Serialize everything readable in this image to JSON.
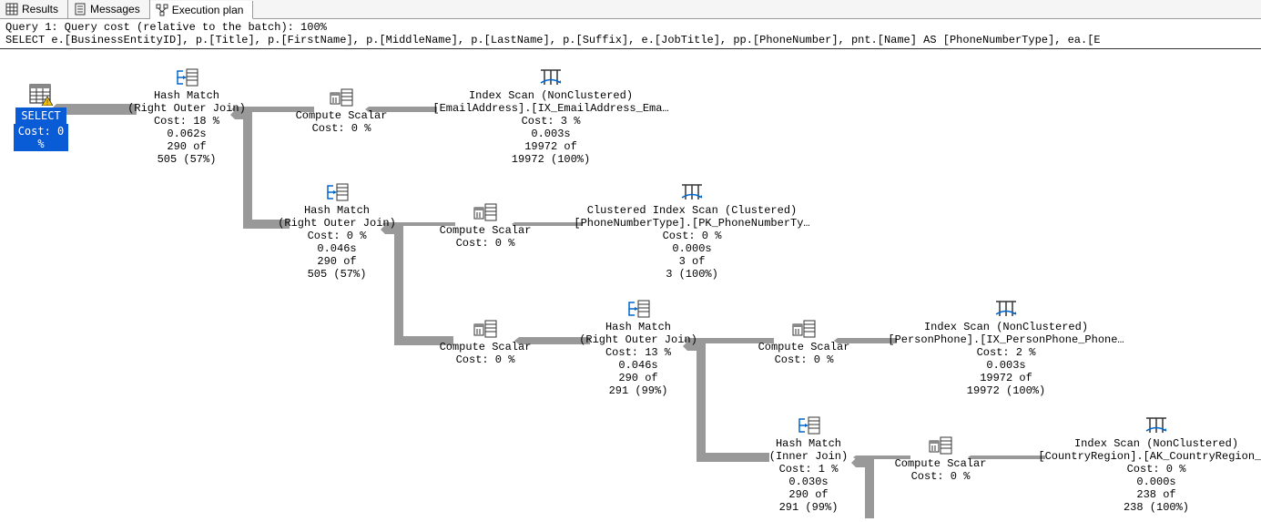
{
  "tabs": {
    "results": "Results",
    "messages": "Messages",
    "exec_plan": "Execution plan"
  },
  "header": {
    "query_cost": "Query 1: Query cost (relative to the batch): 100%",
    "query_text": "SELECT e.[BusinessEntityID], p.[Title], p.[FirstName], p.[MiddleName], p.[LastName], p.[Suffix], e.[JobTitle], pp.[PhoneNumber], pnt.[Name] AS [PhoneNumberType], ea.[E"
  },
  "nodes": {
    "select": {
      "label": "SELECT",
      "cost": "Cost: 0 %"
    },
    "hm1": {
      "l1": "Hash Match",
      "l2": "(Right Outer Join)",
      "l3": "Cost: 18 %",
      "l4": "0.062s",
      "l5": "290 of",
      "l6": "505 (57%)"
    },
    "cs1": {
      "l1": "Compute Scalar",
      "l2": "Cost: 0 %"
    },
    "scan1": {
      "l1": "Index Scan (NonClustered)",
      "l2": "[EmailAddress].[IX_EmailAddress_Ema…",
      "l3": "Cost: 3 %",
      "l4": "0.003s",
      "l5": "19972 of",
      "l6": "19972 (100%)"
    },
    "hm2": {
      "l1": "Hash Match",
      "l2": "(Right Outer Join)",
      "l3": "Cost: 0 %",
      "l4": "0.046s",
      "l5": "290 of",
      "l6": "505 (57%)"
    },
    "cs2": {
      "l1": "Compute Scalar",
      "l2": "Cost: 0 %"
    },
    "scan2": {
      "l1": "Clustered Index Scan (Clustered)",
      "l2": "[PhoneNumberType].[PK_PhoneNumberTy…",
      "l3": "Cost: 0 %",
      "l4": "0.000s",
      "l5": "3 of",
      "l6": "3 (100%)"
    },
    "cs3": {
      "l1": "Compute Scalar",
      "l2": "Cost: 0 %"
    },
    "hm3": {
      "l1": "Hash Match",
      "l2": "(Right Outer Join)",
      "l3": "Cost: 13 %",
      "l4": "0.046s",
      "l5": "290 of",
      "l6": "291 (99%)"
    },
    "cs4": {
      "l1": "Compute Scalar",
      "l2": "Cost: 0 %"
    },
    "scan3": {
      "l1": "Index Scan (NonClustered)",
      "l2": "[PersonPhone].[IX_PersonPhone_Phone…",
      "l3": "Cost: 2 %",
      "l4": "0.003s",
      "l5": "19972 of",
      "l6": "19972 (100%)"
    },
    "hm4": {
      "l1": "Hash Match",
      "l2": "(Inner Join)",
      "l3": "Cost: 1 %",
      "l4": "0.030s",
      "l5": "290 of",
      "l6": "291 (99%)"
    },
    "cs5": {
      "l1": "Compute Scalar",
      "l2": "Cost: 0 %"
    },
    "scan4": {
      "l1": "Index Scan (NonClustered)",
      "l2": "[CountryRegion].[AK_CountryRegion_N…",
      "l3": "Cost: 0 %",
      "l4": "0.000s",
      "l5": "238 of",
      "l6": "238 (100%)"
    }
  }
}
